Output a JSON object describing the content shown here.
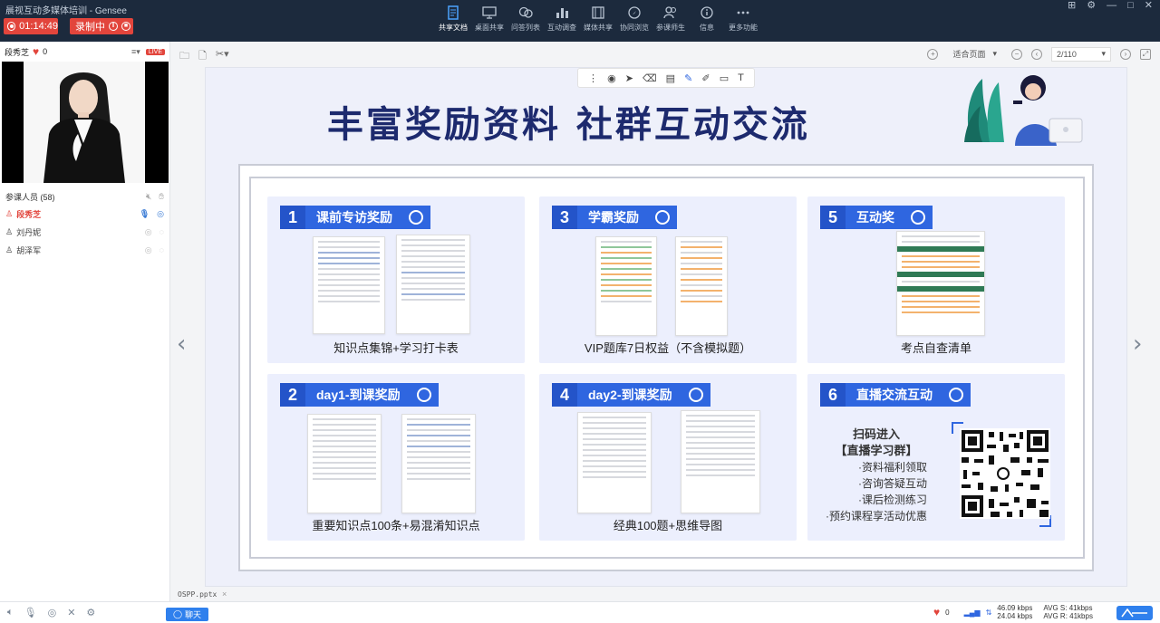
{
  "window": {
    "title": "晨视互动多媒体培训 - Gensee"
  },
  "recording": {
    "timer": "01:14:49",
    "state": "录制中"
  },
  "top_tools": [
    {
      "label": "共享文档",
      "icon": "document-share-icon",
      "active": true
    },
    {
      "label": "桌面共享",
      "icon": "desktop-share-icon"
    },
    {
      "label": "问答列表",
      "icon": "qa-list-icon"
    },
    {
      "label": "互动调查",
      "icon": "survey-icon"
    },
    {
      "label": "媒体共享",
      "icon": "media-share-icon"
    },
    {
      "label": "协同浏览",
      "icon": "co-browse-icon"
    },
    {
      "label": "参课师生",
      "icon": "participants-icon"
    },
    {
      "label": "信息",
      "icon": "info-icon"
    },
    {
      "label": "更多功能",
      "icon": "more-icon"
    }
  ],
  "presenter": {
    "name": "段秀芝",
    "likes": "0",
    "live": "LIVE"
  },
  "attendees": {
    "header": "参课人员 (58)",
    "list": [
      {
        "name": "段秀芝",
        "host": true
      },
      {
        "name": "刘丹妮"
      },
      {
        "name": "胡泽军"
      }
    ]
  },
  "doc_toolbar": {
    "zoom": "适合页面",
    "page": "2/110"
  },
  "file": {
    "name": "OSPP.pptx"
  },
  "slide": {
    "title": "丰富奖励资料 社群互动交流",
    "cards": [
      {
        "num": "1",
        "label": "课前专访奖励",
        "caption": "知识点集锦+学习打卡表"
      },
      {
        "num": "3",
        "label": "学霸奖励",
        "caption": "VIP题库7日权益（不含模拟题）"
      },
      {
        "num": "5",
        "label": "互动奖",
        "caption": "考点自查清单"
      },
      {
        "num": "2",
        "label": "day1-到课奖励",
        "caption": "重要知识点100条+易混淆知识点"
      },
      {
        "num": "4",
        "label": "day2-到课奖励",
        "caption": "经典100题+思维导图"
      },
      {
        "num": "6",
        "label": "直播交流互动",
        "caption": ""
      }
    ],
    "qr": {
      "line1": "扫码进入",
      "line2": "【直播学习群】",
      "bullets": [
        "·资料福利领取",
        "·咨询答疑互动",
        "·课后检测练习",
        "·预约课程享活动优惠"
      ]
    }
  },
  "bottom": {
    "chat": "聊天",
    "likes": "0",
    "speed_up": "46.09 kbps",
    "speed_down": "24.04 kbps",
    "avg_s": "AVG S: 41kbps",
    "avg_r": "AVG R: 41kbps"
  },
  "colors": {
    "accent": "#2f66e0",
    "record_red": "#e2453c",
    "title_navy": "#1d2a6e",
    "topbar": "#1c2a3d"
  }
}
